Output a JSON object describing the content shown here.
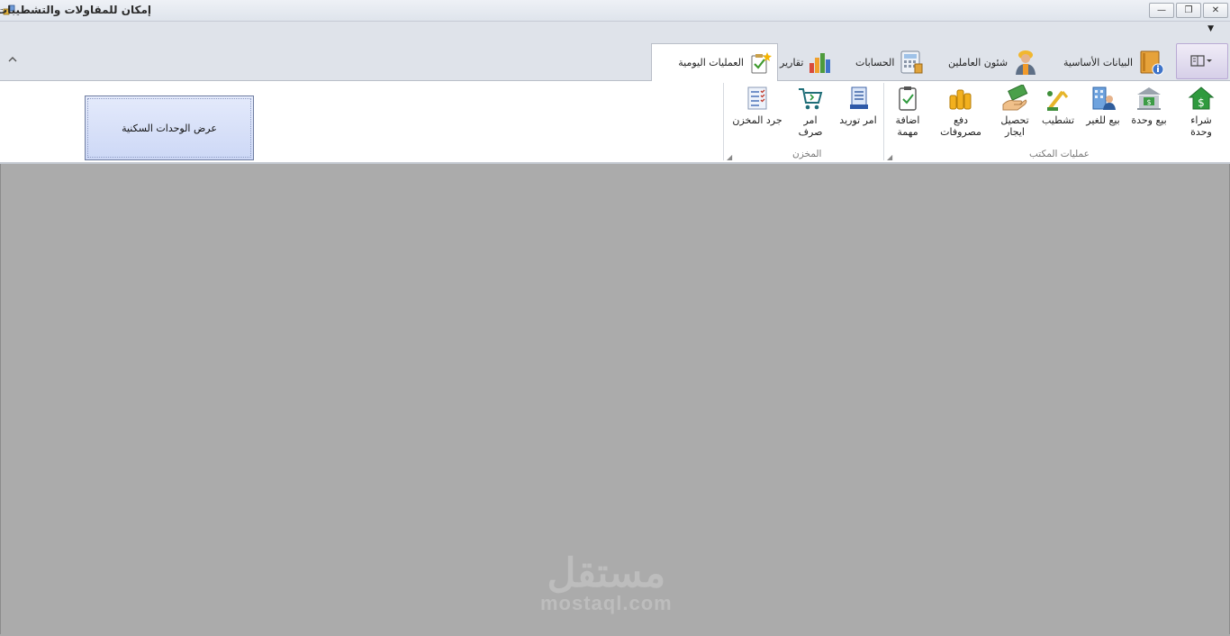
{
  "window": {
    "title": "إمكان للمقاولات والتشطيبات",
    "minimize_icon": "minimize-icon",
    "restore_icon": "restore-icon",
    "close_icon": "close-icon",
    "minimize_glyph": "—",
    "restore_glyph": "❐",
    "close_glyph": "✕"
  },
  "qat": {
    "dropdown_glyph": "▼"
  },
  "ribbon_tabs": [
    {
      "label": "البيانات الأساسية",
      "icon": "book-info-icon"
    },
    {
      "label": "شئون العاملين",
      "icon": "worker-icon"
    },
    {
      "label": "الحسابات",
      "icon": "calculator-icon"
    },
    {
      "label": "تقارير",
      "icon": "bar-chart-icon"
    },
    {
      "label": "العمليات اليومية",
      "icon": "checklist-star-icon",
      "active": true
    }
  ],
  "office_group": {
    "label": "عمليات المكتب",
    "buttons": [
      {
        "label": "شراء وحدة",
        "icon": "house-dollar-icon"
      },
      {
        "label": "بيع وحدة",
        "icon": "bank-dollar-icon"
      },
      {
        "label": "بيع للغير",
        "icon": "building-person-icon"
      },
      {
        "label": "تشطيب",
        "icon": "crane-icon"
      },
      {
        "label": "تحصيل ايجار",
        "icon": "cash-hand-icon"
      },
      {
        "label": "دفع مصروفات",
        "icon": "coins-stack-icon"
      },
      {
        "label": "اضافة مهمة",
        "icon": "clipboard-check-icon"
      }
    ]
  },
  "store_group": {
    "label": "المخزن",
    "buttons": [
      {
        "label": "امر توريد",
        "icon": "stack-document-icon"
      },
      {
        "label": "امر صرف",
        "icon": "shopping-cart-icon"
      },
      {
        "label": "جرد المخزن",
        "icon": "checklist-icon"
      }
    ]
  },
  "main_button": {
    "label": "عرض الوحدات السكنية"
  },
  "watermark": {
    "arabic": "مستقل",
    "latin": "mostaql.com"
  },
  "colors": {
    "workspace": "#ababab",
    "ribbon": "#ffffff",
    "tabstrip": "#dfe3ea",
    "button_blue": "#cdd8f6"
  }
}
